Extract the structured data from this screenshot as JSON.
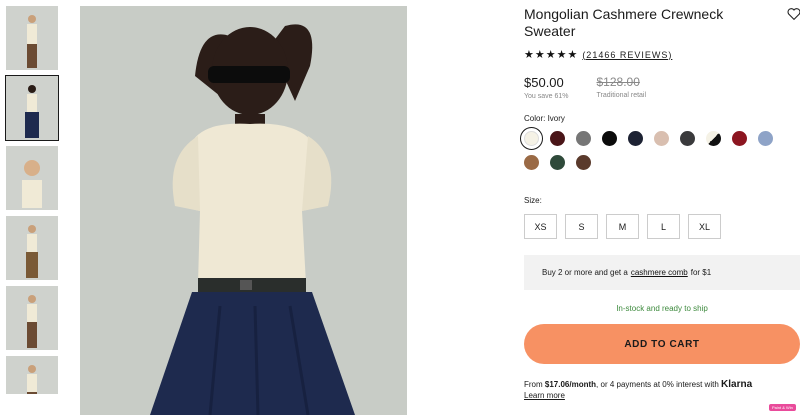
{
  "product": {
    "title": "Mongolian Cashmere Crewneck Sweater",
    "stars": "★★★★★",
    "reviews": "(21466 REVIEWS)",
    "price": "$50.00",
    "savings": "You save 61%",
    "original_price": "$128.00",
    "original_label": "Traditional retail"
  },
  "color": {
    "label": "Color: Ivory",
    "swatches": [
      {
        "name": "ivory",
        "hex": "#f5f2e6",
        "selected": true
      },
      {
        "name": "burgundy",
        "hex": "#4a1518"
      },
      {
        "name": "grey",
        "hex": "#767676"
      },
      {
        "name": "black",
        "hex": "#0b0b0b"
      },
      {
        "name": "navy",
        "hex": "#1d2233"
      },
      {
        "name": "beige",
        "hex": "#d9bfb0"
      },
      {
        "name": "charcoal",
        "hex": "#3a3a3c"
      },
      {
        "name": "black-ivory",
        "hex": "#111111"
      },
      {
        "name": "red",
        "hex": "#8c1520"
      },
      {
        "name": "light-blue",
        "hex": "#8ea3c7"
      },
      {
        "name": "camel",
        "hex": "#9a6a45"
      },
      {
        "name": "forest",
        "hex": "#2f4a3a"
      },
      {
        "name": "chocolate",
        "hex": "#5a3a2c"
      }
    ]
  },
  "size": {
    "label": "Size:",
    "options": [
      "XS",
      "S",
      "M",
      "L",
      "XL"
    ]
  },
  "promo": {
    "pre": "Buy 2 or more and get a",
    "link": "cashmere comb",
    "post": "for $1"
  },
  "stock": "In-stock and ready to ship",
  "cart_label": "ADD TO CART",
  "klarna": {
    "pre": "From",
    "amount": "$17.06/month",
    "post": ", or 4 payments at 0% interest with",
    "brand": "Klarna",
    "learn": "Learn more"
  },
  "badge": "Paint & Win",
  "colors": {
    "accent": "#f79163",
    "stock": "#3d8a3d"
  }
}
